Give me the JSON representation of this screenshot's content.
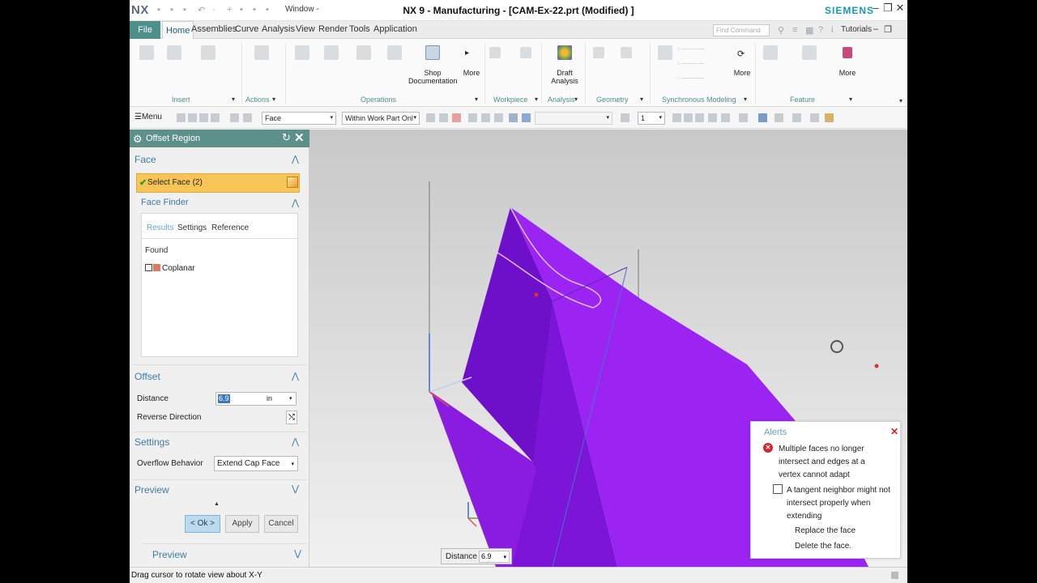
{
  "titlebar": {
    "logo": "NX",
    "window_menu": "Window -",
    "title": "NX 9 - Manufacturing - [CAM-Ex-22.prt (Modified) ]",
    "brand": "SIEMENS",
    "minimize": "–",
    "restore": "❐",
    "close": "✕"
  },
  "ribbon_tabs": {
    "file": "File",
    "items": [
      "Home",
      "Assemblies",
      "Curve",
      "Analysis",
      "View",
      "Render",
      "Tools",
      "Application"
    ],
    "find_placeholder": "Find Command",
    "tutorials": "Tutorials"
  },
  "ribbon": {
    "shop_documentation": "Shop Documentation",
    "more_1": "More",
    "draft_analysis": "Draft Analysis",
    "more_2": "More",
    "more_3": "More",
    "groups": [
      "Insert",
      "Actions",
      "Operations",
      "Workpiece",
      "Analysis",
      "Geometry",
      "Synchronous Modeling",
      "Feature"
    ]
  },
  "selection_bar": {
    "menu": "Menu",
    "filter": "Face",
    "scope": "Within Work Part Onl",
    "layer": "1"
  },
  "dialog": {
    "title": "Offset Region",
    "face_section": "Face",
    "select_face": "Select Face (2)",
    "face_finder": "Face Finder",
    "tabs": [
      "Results",
      "Settings",
      "Reference"
    ],
    "found": "Found",
    "coplanar": "Coplanar",
    "offset_section": "Offset",
    "distance_label": "Distance",
    "distance_value": "6.9",
    "distance_unit": "in",
    "reverse_label": "Reverse Direction",
    "settings_section": "Settings",
    "overflow_label": "Overflow Behavior",
    "overflow_value": "Extend Cap Face",
    "preview_section": "Preview",
    "ok": "< Ok >",
    "apply": "Apply",
    "cancel": "Cancel",
    "preview_bottom": "Preview"
  },
  "viewport": {
    "distance_label": "Distance",
    "distance_value": "6.9",
    "model_color": "#8a1ce0"
  },
  "alerts": {
    "title": "Alerts",
    "message_1": "Multiple faces no longer intersect and edges at a vertex cannot adapt",
    "message_2": "A tangent neighbor might not intersect properly when extending",
    "option_replace": "Replace the face",
    "option_delete": "Delete the face."
  },
  "status": {
    "text": "Drag cursor to rotate view about X-Y"
  }
}
